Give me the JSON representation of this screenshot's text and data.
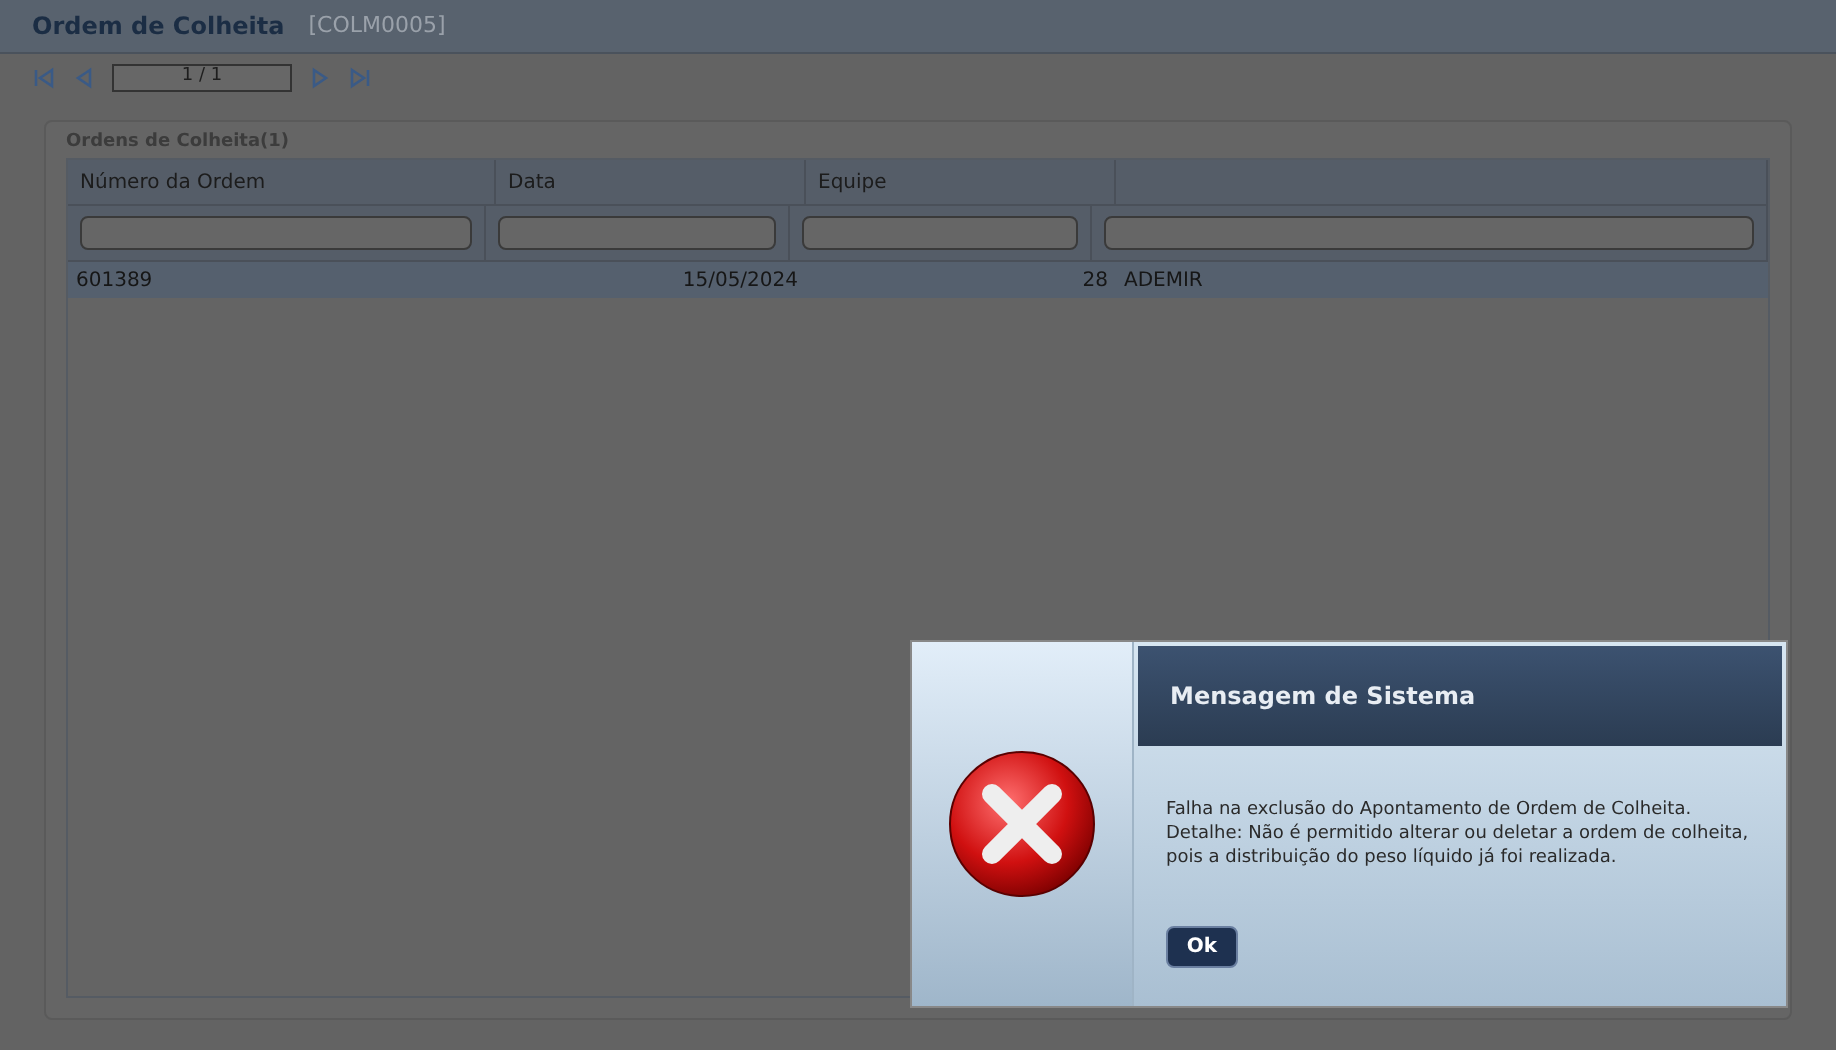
{
  "window": {
    "title": "Ordem de Colheita",
    "code": "[COLM0005]"
  },
  "pager": {
    "value": "1 / 1"
  },
  "panel": {
    "title": "Ordens de Colheita(1)"
  },
  "table": {
    "columns": [
      "Número da Ordem",
      "Data",
      "Equipe",
      ""
    ],
    "rows": [
      {
        "cells": [
          "601389",
          "15/05/2024",
          "28",
          "ADEMIR"
        ],
        "selected": true
      }
    ]
  },
  "dialog": {
    "title": "Mensagem de Sistema",
    "message": [
      "Falha na exclusão do Apontamento de Ordem de Colheita.",
      "Detalhe: Não é permitido alterar ou deletar a ordem de colheita,",
      "pois a distribuição do peso líquido já foi realizada."
    ],
    "button": "Ok"
  }
}
